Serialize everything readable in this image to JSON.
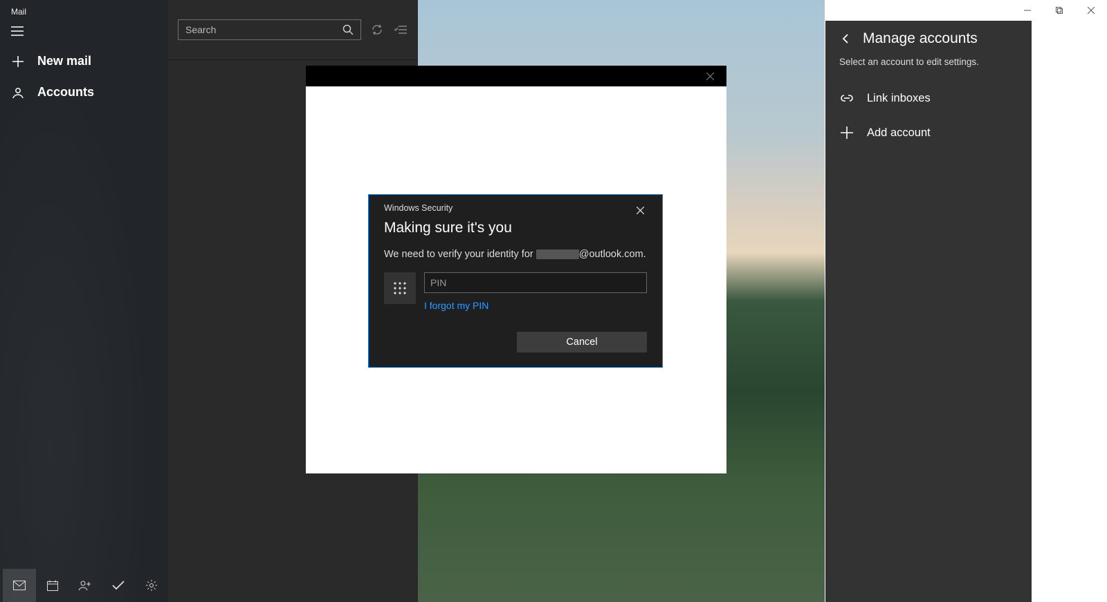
{
  "app": {
    "title": "Mail"
  },
  "sidebar": {
    "new_mail": "New mail",
    "accounts": "Accounts"
  },
  "search": {
    "placeholder": "Search"
  },
  "flyout": {
    "title": "Manage accounts",
    "subtitle": "Select an account to edit settings.",
    "link_inboxes": "Link inboxes",
    "add_account": "Add account"
  },
  "security_dialog": {
    "caption": "Windows Security",
    "title": "Making sure it's you",
    "body_prefix": "We need to verify your identity for ",
    "body_suffix": "@outlook.com.",
    "pin_placeholder": "PIN",
    "forgot": "I forgot my PIN",
    "cancel": "Cancel"
  }
}
